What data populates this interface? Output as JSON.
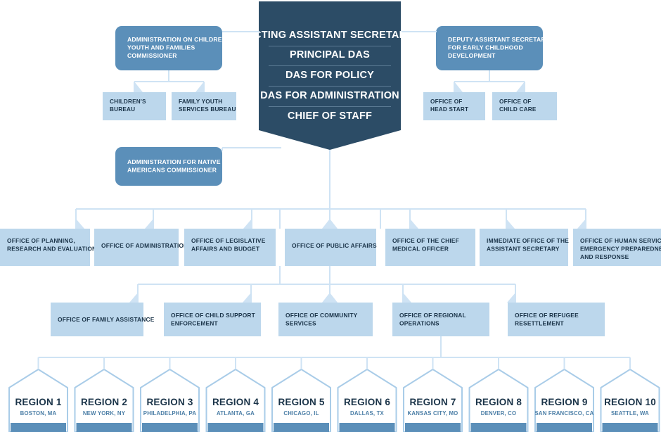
{
  "colors": {
    "navy": "#2c4c66",
    "medium_blue": "#5b8fb9",
    "light_blue": "#bcd7ec",
    "connector": "#cfe3f4",
    "region_border": "#a9cce8",
    "region_bar": "#5b8fb9",
    "background": "#ffffff",
    "text_light": "#ffffff",
    "text_dark": "#1b3449",
    "divider": "#6b8aa3"
  },
  "header_banner": {
    "name": "leadership-banner",
    "lines": [
      "ACTING ASSISTANT SECRETARY",
      "PRINCIPAL DAS",
      "DAS FOR POLICY",
      "DAS FOR ADMINISTRATION",
      "CHIEF OF STAFF"
    ]
  },
  "commissioner_boxes": [
    {
      "id": "acyf",
      "lines": [
        "ADMINISTRATION ON CHILDREN,",
        "YOUTH AND FAMILIES",
        "COMMISSIONER"
      ],
      "children": [
        {
          "id": "childrens-bureau",
          "lines": [
            "CHILDREN'S",
            "BUREAU"
          ]
        },
        {
          "id": "family-youth-services-bureau",
          "lines": [
            "FAMILY YOUTH",
            "SERVICES BUREAU"
          ]
        }
      ]
    },
    {
      "id": "dasecd",
      "lines": [
        "DEPUTY ASSISTANT SECRETARY",
        "FOR EARLY CHILDHOOD",
        "DEVELOPMENT"
      ],
      "children": [
        {
          "id": "office-of-head-start",
          "lines": [
            "OFFICE OF",
            "HEAD START"
          ]
        },
        {
          "id": "office-of-child-care",
          "lines": [
            "OFFICE OF",
            "CHILD CARE"
          ]
        }
      ]
    },
    {
      "id": "ana",
      "lines": [
        "ADMINISTRATION FOR NATIVE",
        "AMERICANS COMMISSIONER"
      ],
      "children": []
    }
  ],
  "tier_offices": [
    {
      "id": "office-of-planning-research-and-evaluation",
      "lines": [
        "OFFICE OF PLANNING,",
        "RESEARCH AND EVALUATION"
      ]
    },
    {
      "id": "office-of-administration",
      "lines": [
        "OFFICE OF ADMINISTRATION"
      ]
    },
    {
      "id": "office-of-legislative-affairs-and-budget",
      "lines": [
        "OFFICE OF LEGISLATIVE",
        "AFFAIRS AND BUDGET"
      ]
    },
    {
      "id": "office-of-public-affairs",
      "lines": [
        "OFFICE OF PUBLIC AFFAIRS"
      ]
    },
    {
      "id": "office-of-the-chief-medical-officer",
      "lines": [
        "OFFICE OF THE CHIEF",
        "MEDICAL OFFICER"
      ]
    },
    {
      "id": "immediate-office-of-the-assistant-secretary",
      "lines": [
        "IMMEDIATE OFFICE OF THE",
        "ASSISTANT SECRETARY"
      ]
    },
    {
      "id": "office-of-human-services-emergency-preparedness-and-response",
      "lines": [
        "OFFICE OF HUMAN SERVICES",
        "EMERGENCY PREPAREDNESS",
        "AND RESPONSE"
      ]
    }
  ],
  "program_offices": [
    {
      "id": "office-of-family-assistance",
      "lines": [
        "OFFICE OF FAMILY ASSISTANCE"
      ]
    },
    {
      "id": "office-of-child-support-enforcement",
      "lines": [
        "OFFICE OF CHILD SUPPORT",
        "ENFORCEMENT"
      ]
    },
    {
      "id": "office-of-community-services",
      "lines": [
        "OFFICE OF COMMUNITY",
        "SERVICES"
      ]
    },
    {
      "id": "office-of-regional-operations",
      "lines": [
        "OFFICE OF REGIONAL",
        "OPERATIONS"
      ]
    },
    {
      "id": "office-of-refugee-resettlement",
      "lines": [
        "OFFICE OF REFUGEE",
        "RESETTLEMENT"
      ]
    }
  ],
  "regions": [
    {
      "id": "region-1",
      "name": "REGION 1",
      "city": "BOSTON, MA"
    },
    {
      "id": "region-2",
      "name": "REGION 2",
      "city": "NEW YORK, NY"
    },
    {
      "id": "region-3",
      "name": "REGION 3",
      "city": "PHILADELPHIA, PA"
    },
    {
      "id": "region-4",
      "name": "REGION 4",
      "city": "ATLANTA, GA"
    },
    {
      "id": "region-5",
      "name": "REGION 5",
      "city": "CHICAGO, IL"
    },
    {
      "id": "region-6",
      "name": "REGION 6",
      "city": "DALLAS, TX"
    },
    {
      "id": "region-7",
      "name": "REGION 7",
      "city": "KANSAS CITY, MO"
    },
    {
      "id": "region-8",
      "name": "REGION 8",
      "city": "DENVER, CO"
    },
    {
      "id": "region-9",
      "name": "REGION 9",
      "city": "SAN FRANCISCO, CA"
    },
    {
      "id": "region-10",
      "name": "REGION 10",
      "city": "SEATTLE, WA"
    }
  ]
}
